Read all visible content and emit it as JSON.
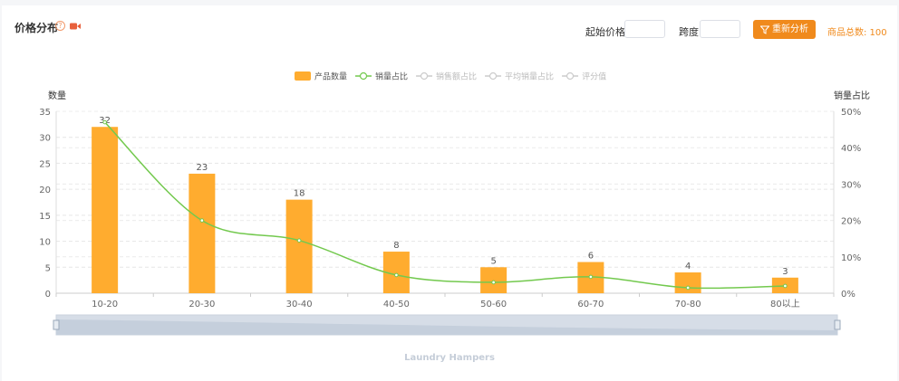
{
  "header": {
    "title": "价格分布",
    "help_icon": "question-circle-icon",
    "video_icon": "video-camera-icon",
    "start_price_label": "起始价格",
    "start_price_value": "",
    "step_label": "跨度",
    "step_value": "",
    "reanalyze_label": "重新分析",
    "reanalyze_icon": "filter-icon",
    "total_label": "商品总数: 100"
  },
  "colors": {
    "bar": "#ffac2f",
    "line": "#73c94e",
    "accent": "#f08a1c",
    "legend_inactive": "#cccccc"
  },
  "chart_data": {
    "type": "bar",
    "categories": [
      "10-20",
      "20-30",
      "30-40",
      "40-50",
      "50-60",
      "60-70",
      "70-80",
      "80以上"
    ],
    "series": [
      {
        "name": "产品数量",
        "type": "bar",
        "axis": "left",
        "values": [
          32,
          23,
          18,
          8,
          5,
          6,
          4,
          3
        ],
        "show_labels": true
      },
      {
        "name": "销量占比",
        "type": "line",
        "axis": "right",
        "values": [
          47,
          20,
          14.5,
          5,
          3,
          4.5,
          1.5,
          2
        ]
      },
      {
        "name": "销售额占比",
        "type": "line",
        "axis": "right",
        "hidden": true
      },
      {
        "name": "平均销量占比",
        "type": "line",
        "axis": "right",
        "hidden": true
      },
      {
        "name": "评分值",
        "type": "line",
        "axis": "right",
        "hidden": true
      }
    ],
    "ylabel_left": "数量",
    "ylabel_right": "销量占比",
    "ylim_left": [
      0,
      35
    ],
    "yticks_left": [
      "0",
      "5",
      "10",
      "15",
      "20",
      "25",
      "30",
      "35"
    ],
    "ylim_right": [
      0,
      50
    ],
    "yticks_right": [
      "0%",
      "10%",
      "20%",
      "30%",
      "40%",
      "50%"
    ],
    "grid": true,
    "legend_position": "top-center",
    "datazoom_caption": "Laundry Hampers"
  }
}
